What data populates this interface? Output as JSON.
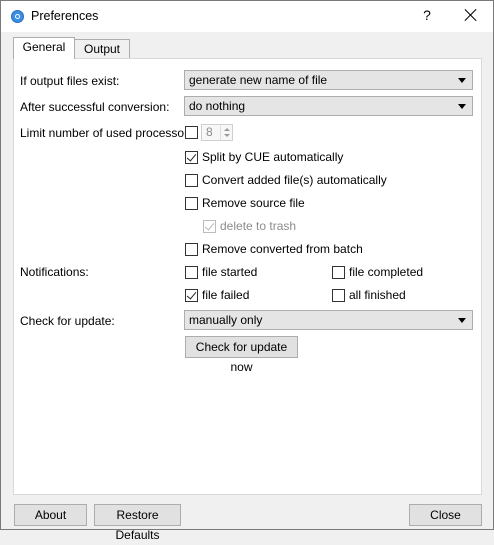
{
  "window": {
    "title": "Preferences",
    "help": "?"
  },
  "tabs": [
    {
      "label": "General"
    },
    {
      "label": "Output"
    }
  ],
  "general": {
    "if_output_exists": {
      "label": "If output files exist:",
      "value": "generate new name of file"
    },
    "after_conversion": {
      "label": "After successful conversion:",
      "value": "do nothing"
    },
    "limit_processors": {
      "label": "Limit number of used processors:",
      "checked": false,
      "value": "8"
    },
    "split_cue": {
      "label": "Split by CUE automatically",
      "checked": true
    },
    "convert_added": {
      "label": "Convert added file(s) automatically",
      "checked": false
    },
    "remove_source": {
      "label": "Remove source file",
      "checked": false
    },
    "delete_to_trash": {
      "label": "delete to trash",
      "checked": true,
      "disabled": true
    },
    "remove_converted": {
      "label": "Remove converted from batch",
      "checked": false
    },
    "notifications": {
      "label": "Notifications:",
      "file_started": {
        "label": "file started",
        "checked": false
      },
      "file_completed": {
        "label": "file completed",
        "checked": false
      },
      "file_failed": {
        "label": "file failed",
        "checked": true
      },
      "all_finished": {
        "label": "all finished",
        "checked": false
      }
    },
    "check_update": {
      "label": "Check for update:",
      "value": "manually only",
      "button": "Check for update now"
    }
  },
  "footer": {
    "about": "About",
    "restore": "Restore Defaults",
    "close": "Close"
  }
}
